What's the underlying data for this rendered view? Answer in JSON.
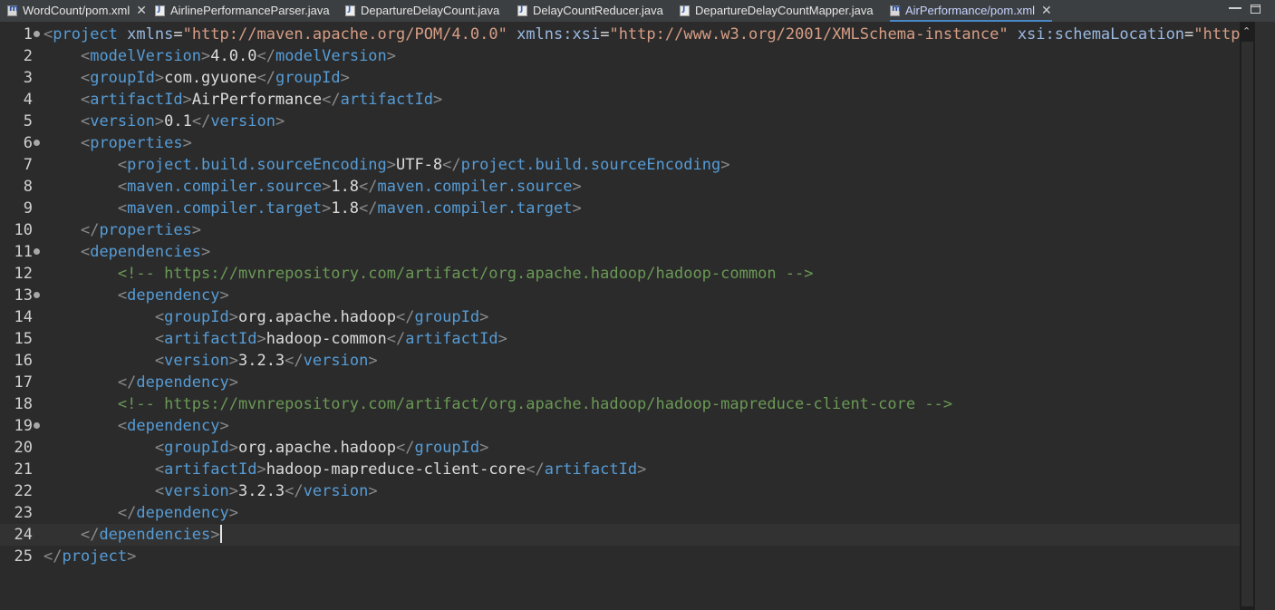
{
  "tabs": [
    {
      "label": "WordCount/pom.xml",
      "type": "xml",
      "closable": true,
      "active": false
    },
    {
      "label": "AirlinePerformanceParser.java",
      "type": "java",
      "closable": false,
      "active": false
    },
    {
      "label": "DepartureDelayCount.java",
      "type": "java",
      "closable": false,
      "active": false
    },
    {
      "label": "DelayCountReducer.java",
      "type": "java",
      "closable": false,
      "active": false
    },
    {
      "label": "DepartureDelayCountMapper.java",
      "type": "java",
      "closable": false,
      "active": false
    },
    {
      "label": "AirPerformance/pom.xml",
      "type": "xml",
      "closable": true,
      "active": true
    }
  ],
  "editor": {
    "current_line": 24,
    "lines": [
      {
        "n": "1",
        "fold": true,
        "tokens": [
          {
            "t": "ang",
            "v": "<"
          },
          {
            "t": "tag",
            "v": "project"
          },
          {
            "t": "txt",
            "v": " "
          },
          {
            "t": "attr",
            "v": "xmlns"
          },
          {
            "t": "txt",
            "v": "="
          },
          {
            "t": "str",
            "v": "\"http://maven.apache.org/POM/4.0.0\""
          },
          {
            "t": "txt",
            "v": " "
          },
          {
            "t": "attr",
            "v": "xmlns:xsi"
          },
          {
            "t": "txt",
            "v": "="
          },
          {
            "t": "str",
            "v": "\"http://www.w3.org/2001/XMLSchema-instance\""
          },
          {
            "t": "txt",
            "v": " "
          },
          {
            "t": "attr",
            "v": "xsi:schemaLocation"
          },
          {
            "t": "txt",
            "v": "="
          },
          {
            "t": "str",
            "v": "\"http://"
          }
        ]
      },
      {
        "n": "2",
        "fold": false,
        "tokens": [
          {
            "t": "txt",
            "v": "    "
          },
          {
            "t": "ang",
            "v": "<"
          },
          {
            "t": "tag",
            "v": "modelVersion"
          },
          {
            "t": "ang",
            "v": ">"
          },
          {
            "t": "txt",
            "v": "4.0.0"
          },
          {
            "t": "ang",
            "v": "</"
          },
          {
            "t": "tag",
            "v": "modelVersion"
          },
          {
            "t": "ang",
            "v": ">"
          }
        ]
      },
      {
        "n": "3",
        "fold": false,
        "tokens": [
          {
            "t": "txt",
            "v": "    "
          },
          {
            "t": "ang",
            "v": "<"
          },
          {
            "t": "tag",
            "v": "groupId"
          },
          {
            "t": "ang",
            "v": ">"
          },
          {
            "t": "txt",
            "v": "com.gyuone"
          },
          {
            "t": "ang",
            "v": "</"
          },
          {
            "t": "tag",
            "v": "groupId"
          },
          {
            "t": "ang",
            "v": ">"
          }
        ]
      },
      {
        "n": "4",
        "fold": false,
        "tokens": [
          {
            "t": "txt",
            "v": "    "
          },
          {
            "t": "ang",
            "v": "<"
          },
          {
            "t": "tag",
            "v": "artifactId"
          },
          {
            "t": "ang",
            "v": ">"
          },
          {
            "t": "txt",
            "v": "AirPerformance"
          },
          {
            "t": "ang",
            "v": "</"
          },
          {
            "t": "tag",
            "v": "artifactId"
          },
          {
            "t": "ang",
            "v": ">"
          }
        ]
      },
      {
        "n": "5",
        "fold": false,
        "tokens": [
          {
            "t": "txt",
            "v": "    "
          },
          {
            "t": "ang",
            "v": "<"
          },
          {
            "t": "tag",
            "v": "version"
          },
          {
            "t": "ang",
            "v": ">"
          },
          {
            "t": "txt",
            "v": "0.1"
          },
          {
            "t": "ang",
            "v": "</"
          },
          {
            "t": "tag",
            "v": "version"
          },
          {
            "t": "ang",
            "v": ">"
          }
        ]
      },
      {
        "n": "6",
        "fold": true,
        "tokens": [
          {
            "t": "txt",
            "v": "    "
          },
          {
            "t": "ang",
            "v": "<"
          },
          {
            "t": "tag",
            "v": "properties"
          },
          {
            "t": "ang",
            "v": ">"
          }
        ]
      },
      {
        "n": "7",
        "fold": false,
        "tokens": [
          {
            "t": "txt",
            "v": "        "
          },
          {
            "t": "ang",
            "v": "<"
          },
          {
            "t": "tag",
            "v": "project.build.sourceEncoding"
          },
          {
            "t": "ang",
            "v": ">"
          },
          {
            "t": "txt",
            "v": "UTF-8"
          },
          {
            "t": "ang",
            "v": "</"
          },
          {
            "t": "tag",
            "v": "project.build.sourceEncoding"
          },
          {
            "t": "ang",
            "v": ">"
          }
        ]
      },
      {
        "n": "8",
        "fold": false,
        "tokens": [
          {
            "t": "txt",
            "v": "        "
          },
          {
            "t": "ang",
            "v": "<"
          },
          {
            "t": "tag",
            "v": "maven.compiler.source"
          },
          {
            "t": "ang",
            "v": ">"
          },
          {
            "t": "txt",
            "v": "1.8"
          },
          {
            "t": "ang",
            "v": "</"
          },
          {
            "t": "tag",
            "v": "maven.compiler.source"
          },
          {
            "t": "ang",
            "v": ">"
          }
        ]
      },
      {
        "n": "9",
        "fold": false,
        "tokens": [
          {
            "t": "txt",
            "v": "        "
          },
          {
            "t": "ang",
            "v": "<"
          },
          {
            "t": "tag",
            "v": "maven.compiler.target"
          },
          {
            "t": "ang",
            "v": ">"
          },
          {
            "t": "txt",
            "v": "1.8"
          },
          {
            "t": "ang",
            "v": "</"
          },
          {
            "t": "tag",
            "v": "maven.compiler.target"
          },
          {
            "t": "ang",
            "v": ">"
          }
        ]
      },
      {
        "n": "10",
        "fold": false,
        "tokens": [
          {
            "t": "txt",
            "v": "    "
          },
          {
            "t": "ang",
            "v": "</"
          },
          {
            "t": "tag",
            "v": "properties"
          },
          {
            "t": "ang",
            "v": ">"
          }
        ]
      },
      {
        "n": "11",
        "fold": true,
        "tokens": [
          {
            "t": "txt",
            "v": "    "
          },
          {
            "t": "ang",
            "v": "<"
          },
          {
            "t": "tag",
            "v": "dependencies"
          },
          {
            "t": "ang",
            "v": ">"
          }
        ]
      },
      {
        "n": "12",
        "fold": false,
        "tokens": [
          {
            "t": "txt",
            "v": "        "
          },
          {
            "t": "cmt",
            "v": "<!-- https://mvnrepository.com/artifact/org.apache.hadoop/hadoop-common -->"
          }
        ]
      },
      {
        "n": "13",
        "fold": true,
        "tokens": [
          {
            "t": "txt",
            "v": "        "
          },
          {
            "t": "ang",
            "v": "<"
          },
          {
            "t": "tag",
            "v": "dependency"
          },
          {
            "t": "ang",
            "v": ">"
          }
        ]
      },
      {
        "n": "14",
        "fold": false,
        "tokens": [
          {
            "t": "txt",
            "v": "            "
          },
          {
            "t": "ang",
            "v": "<"
          },
          {
            "t": "tag",
            "v": "groupId"
          },
          {
            "t": "ang",
            "v": ">"
          },
          {
            "t": "txt",
            "v": "org.apache.hadoop"
          },
          {
            "t": "ang",
            "v": "</"
          },
          {
            "t": "tag",
            "v": "groupId"
          },
          {
            "t": "ang",
            "v": ">"
          }
        ]
      },
      {
        "n": "15",
        "fold": false,
        "tokens": [
          {
            "t": "txt",
            "v": "            "
          },
          {
            "t": "ang",
            "v": "<"
          },
          {
            "t": "tag",
            "v": "artifactId"
          },
          {
            "t": "ang",
            "v": ">"
          },
          {
            "t": "txt",
            "v": "hadoop-common"
          },
          {
            "t": "ang",
            "v": "</"
          },
          {
            "t": "tag",
            "v": "artifactId"
          },
          {
            "t": "ang",
            "v": ">"
          }
        ]
      },
      {
        "n": "16",
        "fold": false,
        "tokens": [
          {
            "t": "txt",
            "v": "            "
          },
          {
            "t": "ang",
            "v": "<"
          },
          {
            "t": "tag",
            "v": "version"
          },
          {
            "t": "ang",
            "v": ">"
          },
          {
            "t": "txt",
            "v": "3.2.3"
          },
          {
            "t": "ang",
            "v": "</"
          },
          {
            "t": "tag",
            "v": "version"
          },
          {
            "t": "ang",
            "v": ">"
          }
        ]
      },
      {
        "n": "17",
        "fold": false,
        "tokens": [
          {
            "t": "txt",
            "v": "        "
          },
          {
            "t": "ang",
            "v": "</"
          },
          {
            "t": "tag",
            "v": "dependency"
          },
          {
            "t": "ang",
            "v": ">"
          }
        ]
      },
      {
        "n": "18",
        "fold": false,
        "tokens": [
          {
            "t": "txt",
            "v": "        "
          },
          {
            "t": "cmt",
            "v": "<!-- https://mvnrepository.com/artifact/org.apache.hadoop/hadoop-mapreduce-client-core -->"
          }
        ]
      },
      {
        "n": "19",
        "fold": true,
        "tokens": [
          {
            "t": "txt",
            "v": "        "
          },
          {
            "t": "ang",
            "v": "<"
          },
          {
            "t": "tag",
            "v": "dependency"
          },
          {
            "t": "ang",
            "v": ">"
          }
        ]
      },
      {
        "n": "20",
        "fold": false,
        "tokens": [
          {
            "t": "txt",
            "v": "            "
          },
          {
            "t": "ang",
            "v": "<"
          },
          {
            "t": "tag",
            "v": "groupId"
          },
          {
            "t": "ang",
            "v": ">"
          },
          {
            "t": "txt",
            "v": "org.apache.hadoop"
          },
          {
            "t": "ang",
            "v": "</"
          },
          {
            "t": "tag",
            "v": "groupId"
          },
          {
            "t": "ang",
            "v": ">"
          }
        ]
      },
      {
        "n": "21",
        "fold": false,
        "tokens": [
          {
            "t": "txt",
            "v": "            "
          },
          {
            "t": "ang",
            "v": "<"
          },
          {
            "t": "tag",
            "v": "artifactId"
          },
          {
            "t": "ang",
            "v": ">"
          },
          {
            "t": "txt",
            "v": "hadoop-mapreduce-client-core"
          },
          {
            "t": "ang",
            "v": "</"
          },
          {
            "t": "tag",
            "v": "artifactId"
          },
          {
            "t": "ang",
            "v": ">"
          }
        ]
      },
      {
        "n": "22",
        "fold": false,
        "tokens": [
          {
            "t": "txt",
            "v": "            "
          },
          {
            "t": "ang",
            "v": "<"
          },
          {
            "t": "tag",
            "v": "version"
          },
          {
            "t": "ang",
            "v": ">"
          },
          {
            "t": "txt",
            "v": "3.2.3"
          },
          {
            "t": "ang",
            "v": "</"
          },
          {
            "t": "tag",
            "v": "version"
          },
          {
            "t": "ang",
            "v": ">"
          }
        ]
      },
      {
        "n": "23",
        "fold": false,
        "tokens": [
          {
            "t": "txt",
            "v": "        "
          },
          {
            "t": "ang",
            "v": "</"
          },
          {
            "t": "tag",
            "v": "dependency"
          },
          {
            "t": "ang",
            "v": ">"
          }
        ]
      },
      {
        "n": "24",
        "fold": false,
        "tokens": [
          {
            "t": "txt",
            "v": "    "
          },
          {
            "t": "ang",
            "v": "</"
          },
          {
            "t": "tag",
            "v": "dependencies"
          },
          {
            "t": "ang",
            "v": ">"
          },
          {
            "t": "caret",
            "v": ""
          }
        ]
      },
      {
        "n": "25",
        "fold": false,
        "tokens": [
          {
            "t": "ang",
            "v": "</"
          },
          {
            "t": "tag",
            "v": "project"
          },
          {
            "t": "ang",
            "v": ">"
          }
        ]
      }
    ]
  },
  "colors": {
    "background": "#2b2b2b",
    "tag": "#569cd6",
    "string": "#d69d85",
    "comment": "#6a9955",
    "current_line": "#323232"
  }
}
